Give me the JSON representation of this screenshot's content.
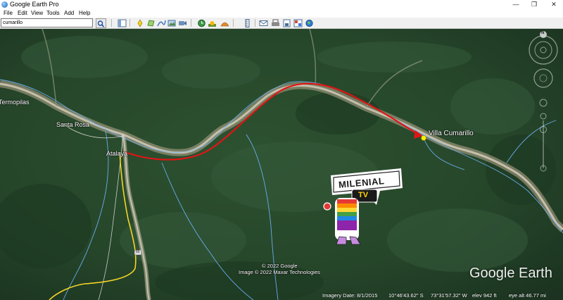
{
  "window": {
    "title": "Google Earth Pro"
  },
  "menu": [
    "File",
    "Edit",
    "View",
    "Tools",
    "Add",
    "Help"
  ],
  "search": {
    "value": "cumarillo"
  },
  "map": {
    "places": {
      "termopilas": "Termopilas",
      "santa_rosa": "Santa Rosa",
      "atalaya": "Atalaya",
      "villa_cumarillo": "Villa Cumarillo"
    },
    "road_shield": "85",
    "copyright": [
      "© 2022 Google",
      "Image © 2022 Maxar Technologies"
    ],
    "logo_text": "Google Earth",
    "compass_letter": "N",
    "watermark": {
      "line1": "MILENIAL",
      "line2": "TV"
    }
  },
  "status": {
    "imagery_date": "Imagery Date: 8/1/2015",
    "lat": "10°46'43.62\" S",
    "lon": "73°31'57.32\" W",
    "elev": "elev   942 ft",
    "eye_alt": "eye alt  46.77 mi"
  },
  "colors": {
    "route": "#e01515",
    "pin": "#ffee00",
    "rivers": "#6fb6ff"
  }
}
